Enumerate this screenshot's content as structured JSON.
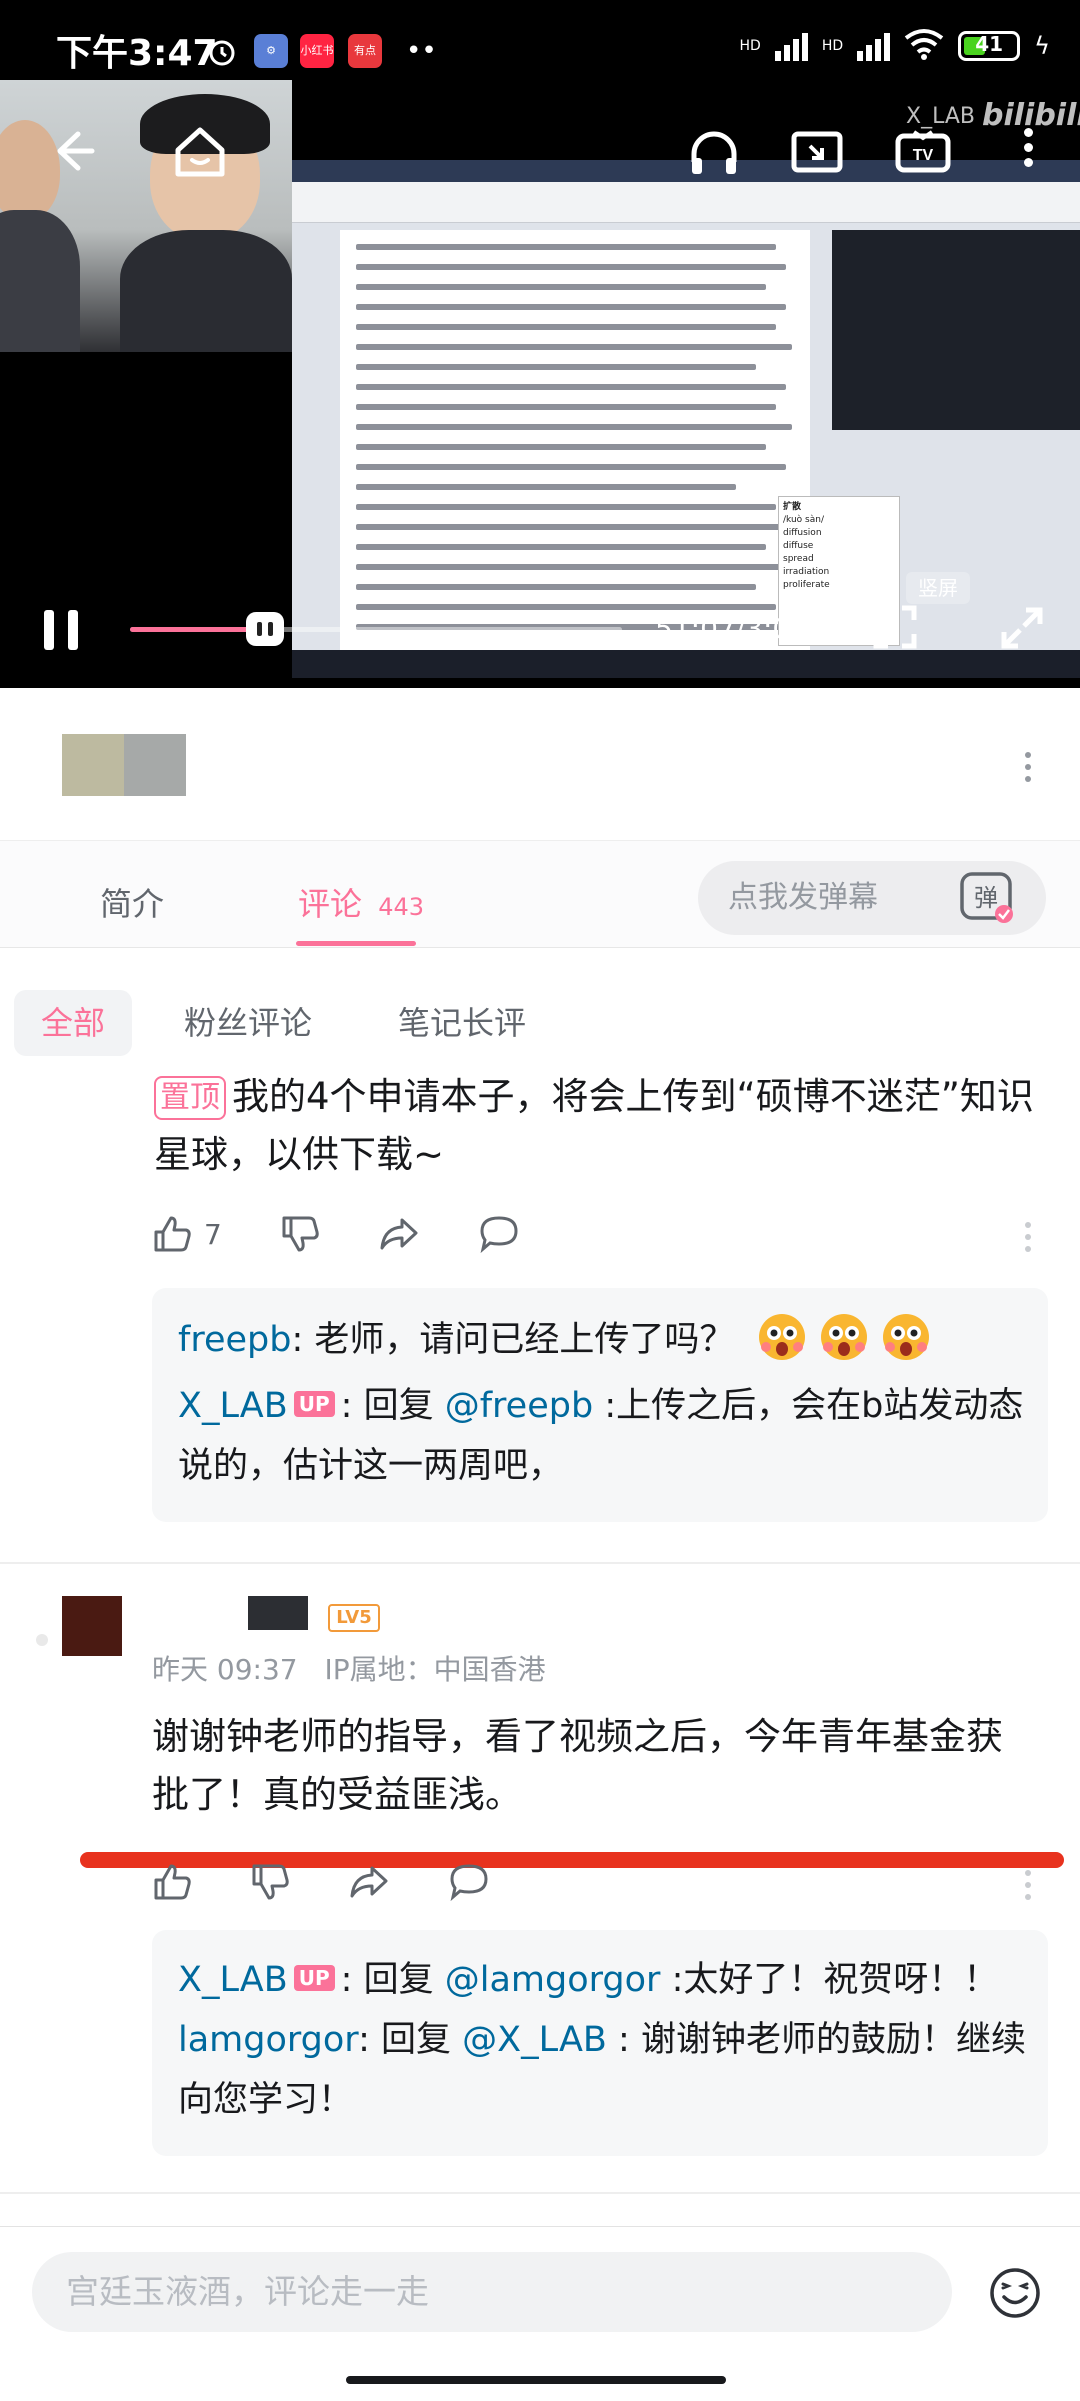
{
  "status_bar": {
    "time": "下午3:47",
    "chip_labels": [
      "小红书",
      "有点"
    ],
    "signal_1": "HD",
    "signal_2": "HD",
    "battery_text": "41",
    "battery_level": 0.41
  },
  "video": {
    "watermark": "X_LAB",
    "brand": "bilibili",
    "elapsed": "51:07",
    "total": "3:06:02",
    "time_display": "51:07/3:06:02",
    "progress": 0.275,
    "portrait_label": "竖屏",
    "dictionary_popup": [
      "扩散",
      "/kuò sàn/",
      "diffusion",
      "diffuse",
      "spread",
      "irradiation",
      "proliferate"
    ]
  },
  "tabs": {
    "intro": "简介",
    "comments": "评论",
    "comment_count": "443",
    "danmaku_placeholder": "点我发弹幕",
    "danmaku_icon_label": "弹"
  },
  "filters": [
    "全部",
    "粉丝评论",
    "笔记长评"
  ],
  "pinned_comment": {
    "badge": "置顶",
    "text": "我的4个申请本子，将会上传到“硕博不迷茫”知识星球，以供下载~",
    "likes": "7",
    "replies": [
      {
        "user": "freepb",
        "sep": ":",
        "text": "老师，请问已经上传了吗？"
      },
      {
        "user": "X_LAB",
        "badge": "UP",
        "sep": ":",
        "prefix": "回复",
        "mention": "@freepb",
        "text": ":上传之后，会在b站发动态说的，估计这一两周吧，"
      }
    ]
  },
  "comment2": {
    "level": "LV5",
    "time": "昨天 09:37",
    "location": "IP属地：中国香港",
    "text": "谢谢钟老师的指导，看了视频之后，今年青年基金获批了！真的受益匪浅。",
    "replies": [
      {
        "user": "X_LAB",
        "badge": "UP",
        "sep": ":",
        "prefix": "回复",
        "mention": "@lamgorgor",
        "text": ":太好了！祝贺呀！！"
      },
      {
        "user": "lamgorgor",
        "sep": ":",
        "prefix": "回复",
        "mention": "@X_LAB",
        "text": ": 谢谢钟老师的鼓励！继续向您学习！"
      }
    ]
  },
  "bottom": {
    "placeholder": "宫廷玉液酒，评论走一走"
  },
  "colors": {
    "accent": "#fb7299",
    "link": "#00699d",
    "highlight_line": "#e8321e",
    "level_badge": "#f29a3a"
  }
}
